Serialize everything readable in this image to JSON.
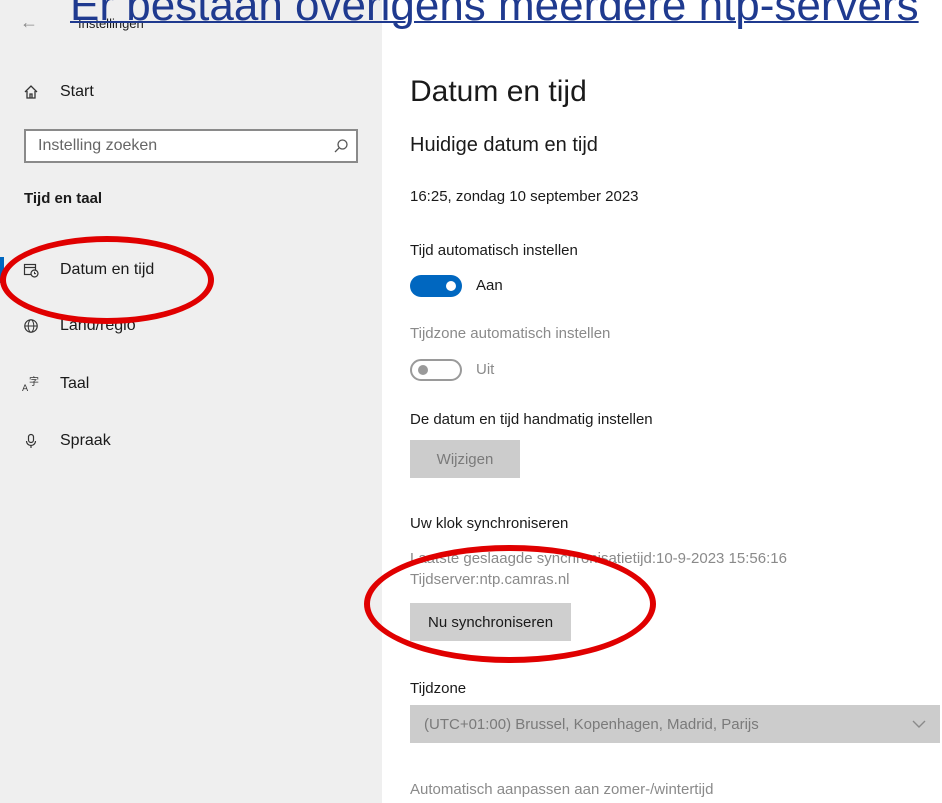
{
  "overlay": {
    "heading": "Er bestaan overigens meerdere ntp-servers"
  },
  "window": {
    "title": "Instellingen"
  },
  "sidebar": {
    "home_label": "Start",
    "search_placeholder": "Instelling zoeken",
    "section_title": "Tijd en taal",
    "items": [
      {
        "label": "Datum en tijd",
        "icon": "calendar-clock-icon",
        "active": true
      },
      {
        "label": "Land/regio",
        "icon": "globe-icon",
        "active": false
      },
      {
        "label": "Taal",
        "icon": "language-icon",
        "active": false
      },
      {
        "label": "Spraak",
        "icon": "microphone-icon",
        "active": false
      }
    ]
  },
  "main": {
    "title": "Datum en tijd",
    "subtitle": "Huidige datum en tijd",
    "current_datetime": "16:25, zondag 10 september 2023",
    "auto_time": {
      "label": "Tijd automatisch instellen",
      "state": "Aan"
    },
    "auto_timezone": {
      "label": "Tijdzone automatisch instellen",
      "state": "Uit"
    },
    "manual": {
      "label": "De datum en tijd handmatig instellen",
      "button": "Wijzigen"
    },
    "sync": {
      "label": "Uw klok synchroniseren",
      "last_sync": "Laatste geslaagde synchronisatietijd:10-9-2023 15:56:16",
      "server": "Tijdserver:ntp.camras.nl",
      "button": "Nu synchroniseren"
    },
    "timezone": {
      "label": "Tijdzone",
      "value": "(UTC+01:00) Brussel, Kopenhagen, Madrid, Parijs"
    },
    "dst_label": "Automatisch aanpassen aan zomer-/wintertijd"
  },
  "colors": {
    "accent": "#0067c0",
    "annotation": "#e00000",
    "heading": "#1f3a8f"
  }
}
